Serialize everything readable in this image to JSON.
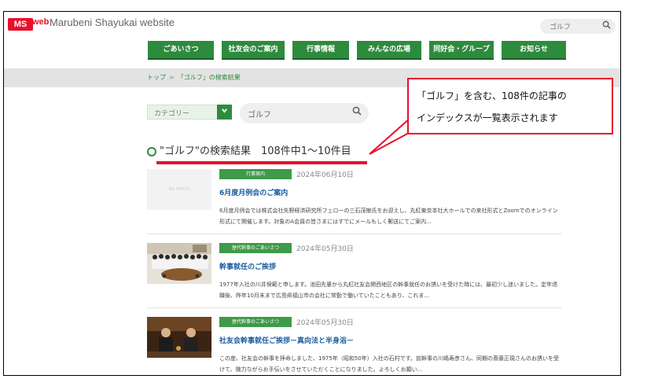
{
  "header": {
    "logo_badge": "MS",
    "logo_web": "web",
    "site_title": "Marubeni Shayukai website",
    "search_value": "ゴルフ"
  },
  "nav": {
    "items": [
      {
        "label": "ごあいさつ"
      },
      {
        "label": "社友会のご案内"
      },
      {
        "label": "行事情報"
      },
      {
        "label": "みんなの広場"
      },
      {
        "label": "同好会・グループ"
      },
      {
        "label": "お知らせ"
      }
    ]
  },
  "breadcrumb": {
    "home": "トップ",
    "separator": ">",
    "current": "「ゴルフ」の検索結果"
  },
  "search": {
    "category_placeholder": "カテゴリー",
    "query": "ゴルフ"
  },
  "results": {
    "title": "\"ゴルフ\"の検索結果　108件中1～10件目"
  },
  "callout": {
    "line1": "「ゴルフ」を含む、108件の記事の",
    "line2": "インデックスが一覧表示されます"
  },
  "articles": [
    {
      "thumb": "NO PHOTO",
      "tag": "行事案内",
      "date": "2024年06月10日",
      "title": "6月度月例会のご案内",
      "excerpt": "6月度月例会では株式会社矢野経済研究所フェローの三石茂樹氏をお迎えし、丸紅東京本社大ホールでの来社形式とZoomでのオンライン形式にて開催します。対象のA会員の皆さまにはすでにメールもしく郵送にてご案内..."
    },
    {
      "tag": "歴代幹事のごあいさつ",
      "date": "2024年05月30日",
      "title": "幹事就任のご挨拶",
      "excerpt": "1977年入社の川井保範と申します。池田先輩から丸紅社友会関西地区の幹事就任のお誘いを受けた時には、最初少し迷いました。定年退職後、昨年10月末まで広島県福山市の会社に常勤で働いていたこともあり、これま..."
    },
    {
      "tag": "歴代幹事のごあいさつ",
      "date": "2024年05月30日",
      "title": "社友会幹事就任ご挨拶－真向法と半身浴－",
      "excerpt": "この度、社友会の幹事を拝命しました、1975年（昭和50年）入社の石村です。前幹事の川嶋寿彦さん、同期の斎藤正現さんのお誘いを受けて、微力ながらお手伝いをさせていただくことになりました。よろしくお願い..."
    }
  ],
  "colors": {
    "brand_red": "#e8102a",
    "nav_green": "#2e8b3e",
    "link_blue": "#1a5aa0"
  }
}
